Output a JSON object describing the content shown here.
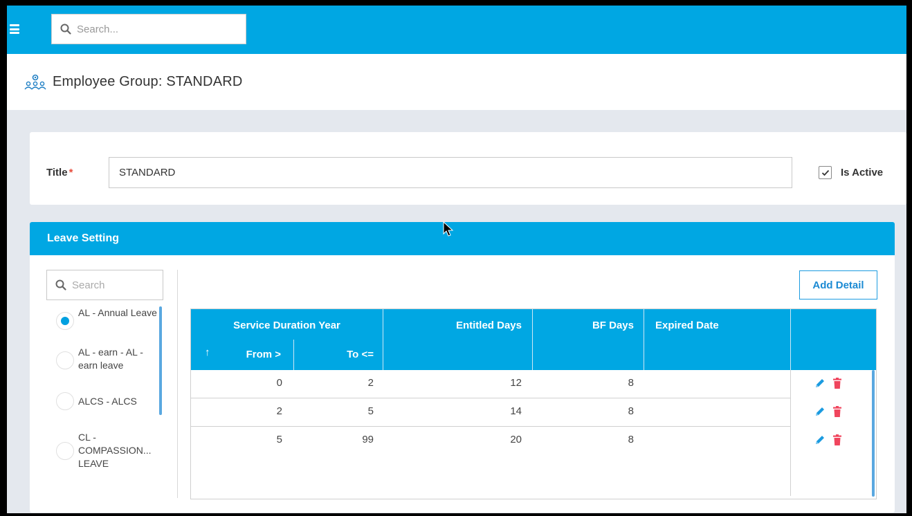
{
  "topbar": {
    "search_placeholder": "Search..."
  },
  "header": {
    "title": "Employee Group: STANDARD"
  },
  "form": {
    "title_label": "Title",
    "title_required": "*",
    "title_value": "STANDARD",
    "is_active_label": "Is Active",
    "is_active": true
  },
  "leave_setting": {
    "heading": "Leave Setting",
    "search_placeholder": "Search",
    "add_button": "Add Detail",
    "leave_types": [
      {
        "label": "AL - Annual Leave",
        "selected": true
      },
      {
        "label": "AL - earn - AL - earn leave",
        "selected": false
      },
      {
        "label": "ALCS - ALCS",
        "selected": false
      },
      {
        "label": "CL - COMPASSION... LEAVE",
        "selected": false
      }
    ],
    "table": {
      "group_header": "Service Duration Year",
      "sort_indicator": "↑",
      "columns": [
        "From >",
        "To <=",
        "Entitled Days",
        "BF Days",
        "Expired Date"
      ],
      "rows": [
        {
          "from": "0",
          "to": "2",
          "entitled": "12",
          "bf": "8",
          "expired": ""
        },
        {
          "from": "2",
          "to": "5",
          "entitled": "14",
          "bf": "8",
          "expired": ""
        },
        {
          "from": "5",
          "to": "99",
          "entitled": "20",
          "bf": "8",
          "expired": ""
        }
      ]
    }
  },
  "colors": {
    "primary": "#00a7e3",
    "edit": "#1b9be0",
    "delete": "#f0455d",
    "required": "#e74c3c"
  }
}
